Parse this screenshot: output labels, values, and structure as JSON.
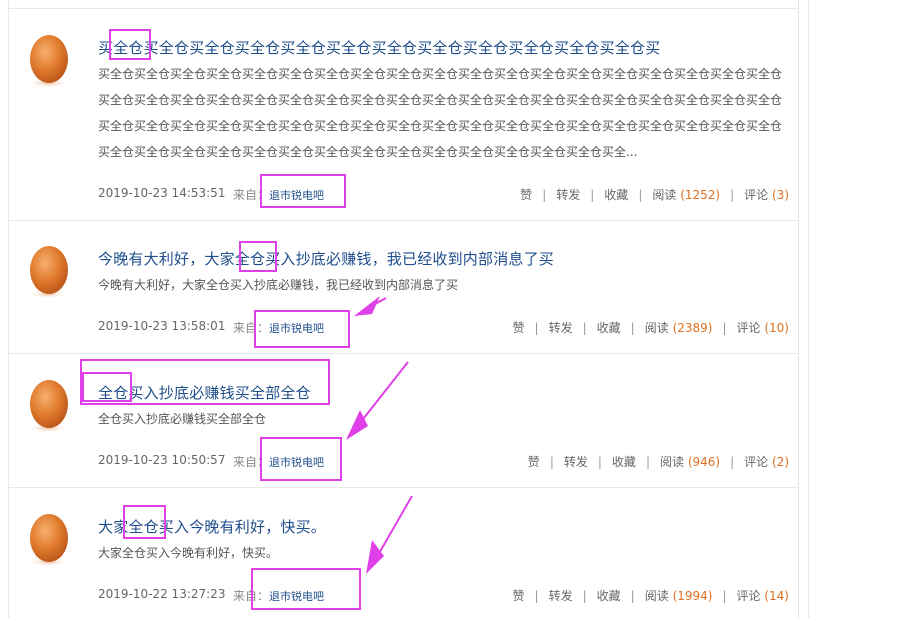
{
  "labels": {
    "from": "来自：",
    "like": "赞",
    "forward": "转发",
    "collect": "收藏",
    "read": "阅读",
    "comment": "评论"
  },
  "posts": [
    {
      "title": "买全仓买全仓买全仓买全仓买全仓买全仓买全仓买全仓买全仓买全仓买全仓买全仓买",
      "summary": "买全仓买全仓买全仓买全仓买全仓买全仓买全仓买全仓买全仓买全仓买全仓买全仓买全仓买全仓买全仓买全仓买全仓买全仓买全仓买全仓买全仓买全仓买全仓买全仓买全仓买全仓买全仓买全仓买全仓买全仓买全仓买全仓买全仓买全仓买全仓买全仓买全仓买全仓买全仓买全仓买全仓买全仓买全仓买全仓买全仓买全仓买全仓买全仓买全仓买全仓买全仓买全仓买全仓买全仓买全仓买全仓买全仓买全仓买全仓买全仓买全仓买全仓买全仓买全仓买全仓买全仓买全仓买全仓买全仓买全仓买全仓买全...",
      "date": "2019-10-23 14:53:51",
      "source": "退市锐电吧",
      "read_count": "(1252)",
      "comment_count": "(3)"
    },
    {
      "title": "今晚有大利好，大家全仓买入抄底必赚钱，我已经收到内部消息了买",
      "summary": "今晚有大利好，大家全仓买入抄底必赚钱，我已经收到内部消息了买",
      "date": "2019-10-23 13:58:01",
      "source": "退市锐电吧",
      "read_count": "(2389)",
      "comment_count": "(10)"
    },
    {
      "title": "全仓买入抄底必赚钱买全部全仓",
      "summary": "全仓买入抄底必赚钱买全部全仓",
      "date": "2019-10-23 10:50:57",
      "source": "退市锐电吧",
      "read_count": "(946)",
      "comment_count": "(2)"
    },
    {
      "title": "大家全仓买入今晚有利好，快买。",
      "summary": "大家全仓买入今晚有利好，快买。",
      "date": "2019-10-22 13:27:23",
      "source": "退市锐电吧",
      "read_count": "(1994)",
      "comment_count": "(14)"
    }
  ],
  "colors": {
    "title": "#1f4e8c",
    "count": "#e07020",
    "annotation": "#e040e8"
  }
}
